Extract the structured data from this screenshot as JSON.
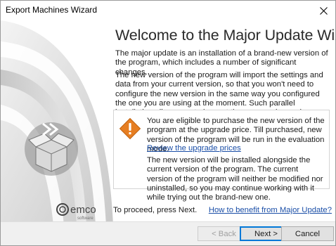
{
  "window": {
    "title": "Export Machines Wizard"
  },
  "main": {
    "heading": "Welcome to the Major Update Wizard",
    "para1": "The major update is an installation of a brand-new version of the program, which includes a number of significant changes.",
    "para2": "The new version of the program will import the settings and data from your current version, so that you won't need to configure the new version in the same way you configured the one you are using at the moment. Such parallel installation allows you to inspect the new version and compare it with the previous one in your environment with your data and settings."
  },
  "info": {
    "icon": "warning-icon",
    "text1": "You are eligible to purchase the new version of the program at the upgrade price. Till purchased, new version of the program will be run in the evaluation mode.",
    "link": "Review the upgrade prices",
    "text2": "The new version will be installed alongside the current version of the program. The current version of the program will neither be modified nor uninstalled, so you may continue working with it while trying out the brand-new one."
  },
  "bottom": {
    "logo_name": "emco",
    "logo_sub": "software",
    "proceed_text": "To proceed, press Next.",
    "benefit_link": "How to benefit from Major Update?"
  },
  "buttons": {
    "back": "< Back",
    "next": "Next >",
    "cancel": "Cancel"
  },
  "colors": {
    "link": "#1a4ea7",
    "warning": "#e67e22",
    "accent": "#0078d7"
  }
}
